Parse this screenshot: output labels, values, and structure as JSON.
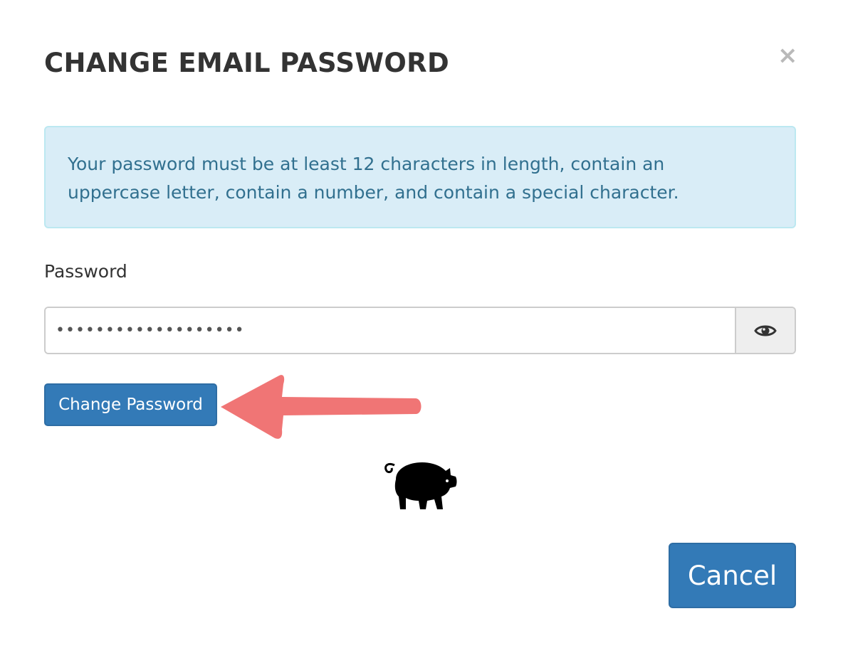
{
  "dialog": {
    "title": "CHANGE EMAIL PASSWORD",
    "close_symbol": "×",
    "close_icon": "close-icon"
  },
  "alert": {
    "line1": "Your password must be at least 12 characters in length, contain an",
    "line2": "uppercase letter, contain a number, and contain a special character."
  },
  "password_field": {
    "label": "Password",
    "value": "•••••••••••••••••••",
    "toggle_icon": "eye-icon"
  },
  "buttons": {
    "change_password": "Change Password",
    "cancel": "Cancel"
  },
  "annotation": {
    "arrow_color": "#f07575",
    "arrow_icon": "arrow-left-icon"
  },
  "decoration": {
    "icon": "pig-icon"
  },
  "colors": {
    "primary": "#337ab7",
    "alert_bg": "#d9edf7",
    "alert_text": "#31708f"
  }
}
